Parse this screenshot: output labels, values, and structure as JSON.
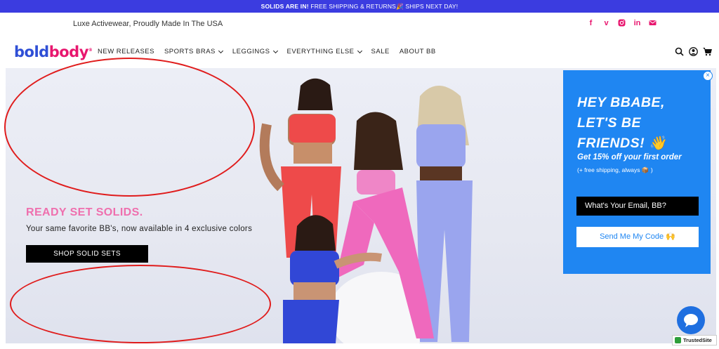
{
  "announcement": {
    "bold": "SOLIDS ARE IN!",
    "text": "FREE SHIPPING & RETURNS",
    "emoji": "🎉",
    "text2": "SHIPS NEXT DAY!"
  },
  "header": {
    "tagline": "Luxe Activewear, Proudly Made In The USA",
    "socials": [
      "facebook-icon",
      "vimeo-icon",
      "instagram-icon",
      "linkedin-icon",
      "email-icon"
    ]
  },
  "nav": {
    "logo_part1": "bold",
    "logo_part2": "body",
    "logo_mark": "®",
    "items": [
      {
        "label": "NEW RELEASES",
        "dropdown": false
      },
      {
        "label": "SPORTS BRAS",
        "dropdown": true
      },
      {
        "label": "LEGGINGS",
        "dropdown": true
      },
      {
        "label": "EVERYTHING ELSE",
        "dropdown": true
      },
      {
        "label": "SALE",
        "dropdown": false
      },
      {
        "label": "ABOUT BB",
        "dropdown": false
      }
    ],
    "icons": [
      "search-icon",
      "account-icon",
      "cart-icon"
    ]
  },
  "hero": {
    "title": "READY SET SOLIDS.",
    "subtitle": "Your same favorite BB's, now available in 4 exclusive colors",
    "button": "SHOP SOLID SETS"
  },
  "popup": {
    "close": "×",
    "title_line1": "HEY BBABE,",
    "title_line2": "LET'S BE",
    "title_line3": "FRIENDS! 👋",
    "offer": "Get 15% off your first order",
    "note": "(+ free shipping, always 📦 )",
    "email_placeholder": "What's Your Email, BB?",
    "button": "Send Me My Code 🙌"
  },
  "badges": {
    "trusted": "TrustedSite"
  },
  "colors": {
    "announcement_bg": "#3b3ce0",
    "brand_blue": "#2f4fd6",
    "brand_pink": "#e8176f",
    "hero_title": "#ef6fae",
    "popup_bg": "#1f86f2",
    "annotation_red": "#e01c1c"
  }
}
